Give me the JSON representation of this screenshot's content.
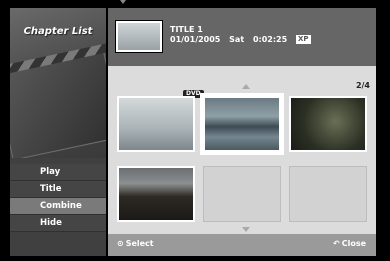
{
  "menu": {
    "title": "Chapter List",
    "items": [
      {
        "label": "Play"
      },
      {
        "label": "Title"
      },
      {
        "label": "Combine"
      },
      {
        "label": "Hide"
      }
    ],
    "selected_index": 2
  },
  "header": {
    "title": "TITLE 1",
    "date": "01/01/2005",
    "day": "Sat",
    "duration": "0:02:25",
    "quality_badge": "XP"
  },
  "grid": {
    "page_indicator": "2/4",
    "disc_tag": "DVD",
    "selected_thumbnail": 2
  },
  "footer": {
    "select_icon": "⊙",
    "select_label": "Select",
    "close_icon": "↶",
    "close_label": "Close"
  }
}
